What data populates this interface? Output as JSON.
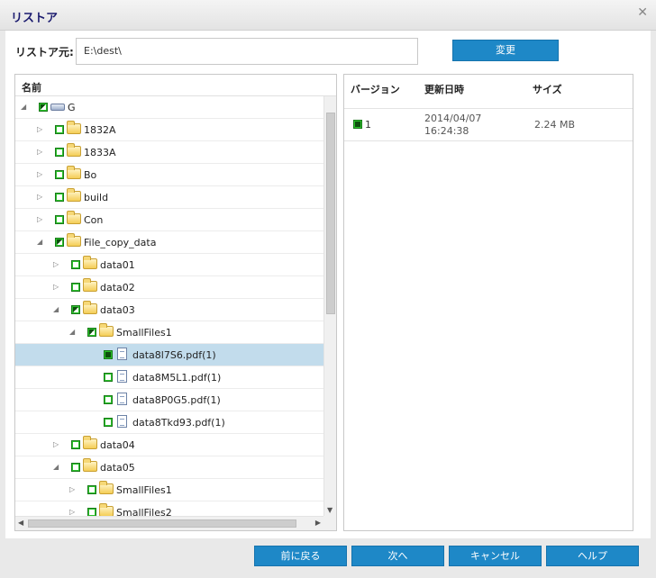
{
  "dialog": {
    "title": "リストア",
    "close_glyph": "✕"
  },
  "source": {
    "label": "リストア元:",
    "value": "E:\\dest\\",
    "change_button": "変更"
  },
  "tree": {
    "header": "名前",
    "rows": [
      {
        "label": "G",
        "indent": 0,
        "expander": "expanded",
        "check": "partial",
        "icon": "drive-icon"
      },
      {
        "label": "1832A",
        "indent": 1,
        "expander": "collapsed",
        "check": "empty",
        "icon": "folder-icon"
      },
      {
        "label": "1833A",
        "indent": 1,
        "expander": "collapsed",
        "check": "empty",
        "icon": "folder-icon"
      },
      {
        "label": "Bo",
        "indent": 1,
        "expander": "collapsed",
        "check": "empty",
        "icon": "folder-icon"
      },
      {
        "label": "build",
        "indent": 1,
        "expander": "collapsed",
        "check": "empty",
        "icon": "folder-icon"
      },
      {
        "label": "Con",
        "indent": 1,
        "expander": "collapsed",
        "check": "empty",
        "icon": "folder-icon"
      },
      {
        "label": "File_copy_data",
        "indent": 1,
        "expander": "expanded",
        "check": "partial",
        "icon": "folder-icon"
      },
      {
        "label": "data01",
        "indent": 2,
        "expander": "collapsed",
        "check": "empty",
        "icon": "folder-icon"
      },
      {
        "label": "data02",
        "indent": 2,
        "expander": "collapsed",
        "check": "empty",
        "icon": "folder-icon"
      },
      {
        "label": "data03",
        "indent": 2,
        "expander": "expanded",
        "check": "partial",
        "icon": "folder-icon"
      },
      {
        "label": "SmallFiles1",
        "indent": 3,
        "expander": "expanded",
        "check": "partial",
        "icon": "folder-icon"
      },
      {
        "label": "data8l7S6.pdf(1)",
        "indent": 4,
        "expander": "none",
        "check": "full",
        "icon": "file-icon",
        "selected": true
      },
      {
        "label": "data8M5L1.pdf(1)",
        "indent": 4,
        "expander": "none",
        "check": "empty",
        "icon": "file-icon"
      },
      {
        "label": "data8P0G5.pdf(1)",
        "indent": 4,
        "expander": "none",
        "check": "empty",
        "icon": "file-icon"
      },
      {
        "label": "data8Tkd93.pdf(1)",
        "indent": 4,
        "expander": "none",
        "check": "empty",
        "icon": "file-icon"
      },
      {
        "label": "data04",
        "indent": 2,
        "expander": "collapsed",
        "check": "empty",
        "icon": "folder-icon"
      },
      {
        "label": "data05",
        "indent": 2,
        "expander": "expanded",
        "check": "empty",
        "icon": "folder-icon"
      },
      {
        "label": "SmallFiles1",
        "indent": 3,
        "expander": "collapsed",
        "check": "empty",
        "icon": "folder-icon"
      },
      {
        "label": "SmallFiles2",
        "indent": 3,
        "expander": "collapsed",
        "check": "empty",
        "icon": "folder-icon"
      }
    ]
  },
  "versions": {
    "columns": {
      "version": "バージョン",
      "modified": "更新日時",
      "size": "サイズ"
    },
    "rows": [
      {
        "version": "1",
        "date": "2014/04/07",
        "time": "16:24:38",
        "size": "2.24 MB"
      }
    ]
  },
  "footer": {
    "back": "前に戻る",
    "next": "次へ",
    "cancel": "キャンセル",
    "help": "ヘルプ"
  }
}
